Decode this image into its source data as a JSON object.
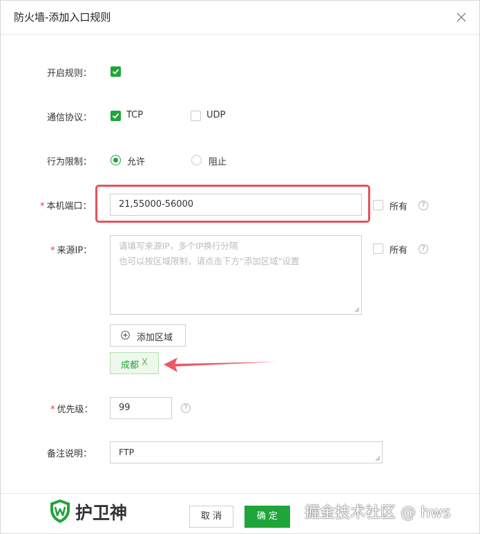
{
  "dialog": {
    "title": "防火墙-添加入口规则"
  },
  "rules": {
    "enable": {
      "label": "开启规则：",
      "checked": true
    },
    "protocol": {
      "label": "通信协议：",
      "options": [
        {
          "label": "TCP",
          "checked": true
        },
        {
          "label": "UDP",
          "checked": false
        }
      ]
    },
    "action": {
      "label": "行为限制：",
      "options": [
        {
          "label": "允许",
          "selected": true
        },
        {
          "label": "阻止",
          "selected": false
        }
      ]
    },
    "local_port": {
      "required_mark": "*",
      "label": "本机端口：",
      "value": "21,55000-56000",
      "all_label": "所有",
      "all_checked": false
    },
    "source_ip": {
      "required_mark": "*",
      "label": "来源IP：",
      "placeholder_line1": "请填写来源IP，多个IP换行分隔",
      "placeholder_line2": "也可以按区域限制，请点击下方\"添加区域\"设置",
      "all_label": "所有",
      "all_checked": false
    },
    "add_area_button": "添加区域",
    "area_tag": {
      "label": "成都",
      "remove": "X"
    },
    "priority": {
      "required_mark": "*",
      "label": "优先级：",
      "value": "99"
    },
    "remark": {
      "label": "备注说明：",
      "value": "FTP"
    }
  },
  "footer": {
    "logo_text": "护卫神",
    "cancel_label": "取 消",
    "ok_label": "确 定",
    "watermark": "掘金技术社区 @ hws"
  },
  "colors": {
    "accent_green": "#20a53a",
    "highlight_red": "#e8505b",
    "required_red": "#e23b3b"
  },
  "icons": [
    "close-icon",
    "checkmark-icon",
    "help-icon",
    "plus-circle-icon",
    "shield-logo-icon",
    "arrow-annotation"
  ]
}
